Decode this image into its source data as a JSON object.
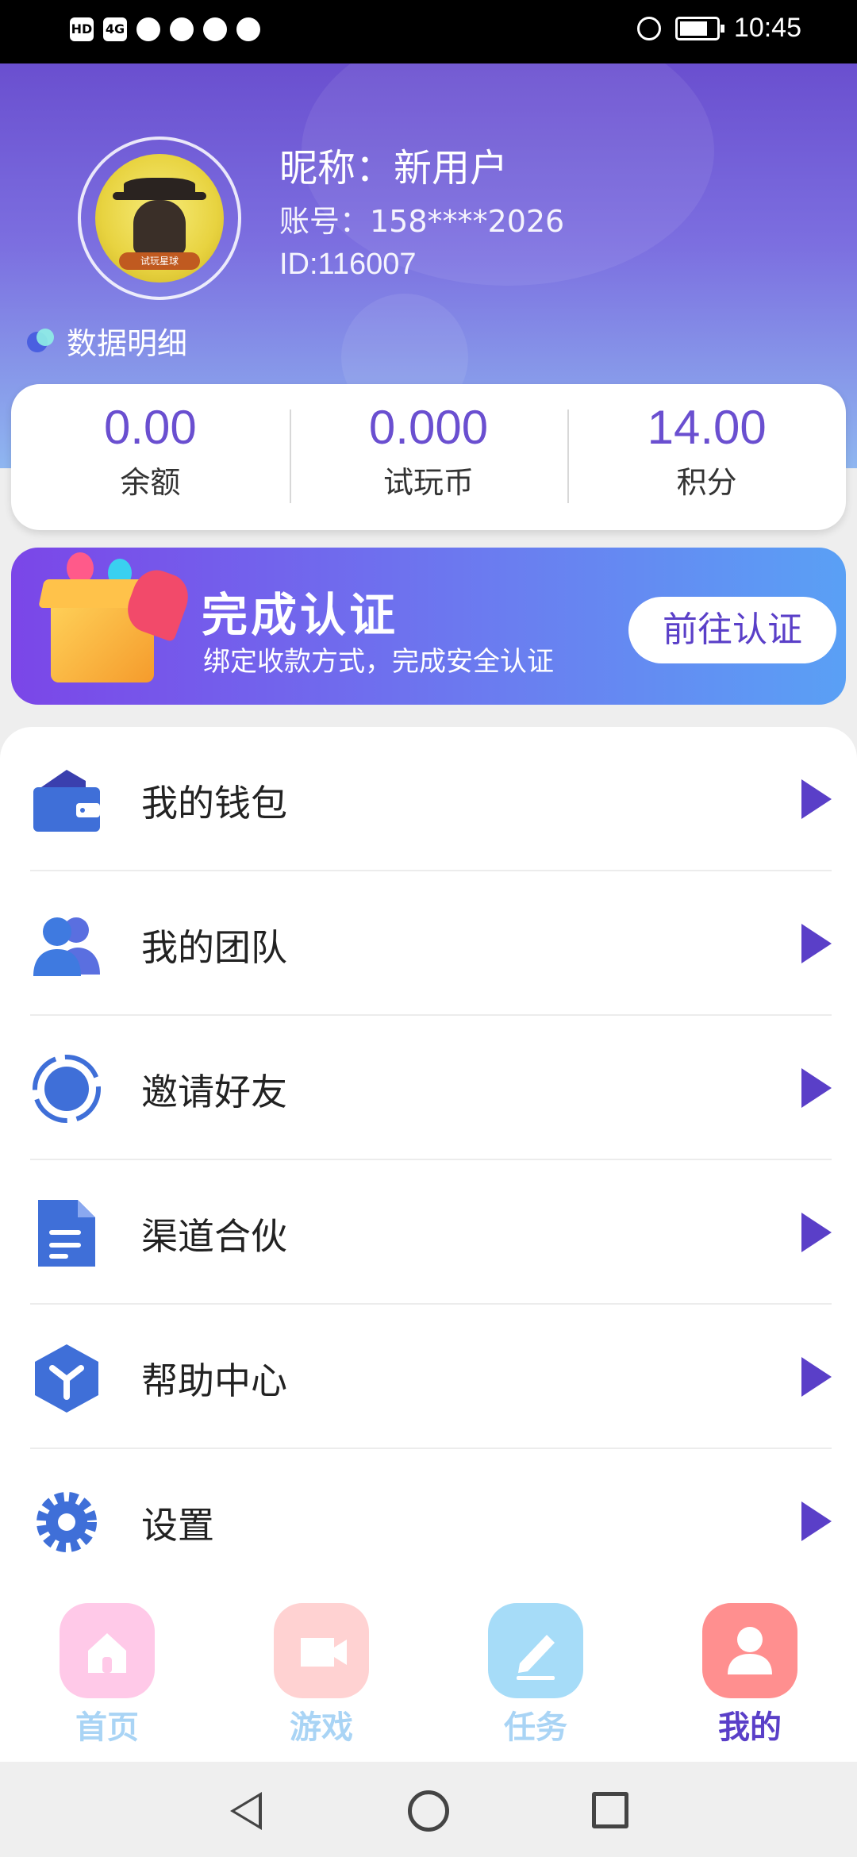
{
  "status_bar": {
    "time": "10:45",
    "left_icons": [
      "HD",
      "4G",
      "signal",
      "wifi",
      "qq",
      "wechat",
      "message"
    ],
    "right_icons": [
      "alarm-icon",
      "battery-icon"
    ]
  },
  "profile": {
    "nickname": "昵称：新用户",
    "account": "账号：158****2026",
    "id": "ID:116007",
    "avatar_label": "试玩星球",
    "data_detail": "数据明细"
  },
  "stats": [
    {
      "value": "0.00",
      "label": "余额"
    },
    {
      "value": "0.000",
      "label": "试玩币"
    },
    {
      "value": "14.00",
      "label": "积分"
    }
  ],
  "banner": {
    "title": "完成认证",
    "subtitle": "绑定收款方式，完成安全认证",
    "button": "前往认证"
  },
  "menu": [
    {
      "label": "我的钱包",
      "icon": "wallet-icon"
    },
    {
      "label": "我的团队",
      "icon": "team-icon"
    },
    {
      "label": "邀请好友",
      "icon": "invite-icon"
    },
    {
      "label": "渠道合伙",
      "icon": "document-icon"
    },
    {
      "label": "帮助中心",
      "icon": "help-cube-icon"
    },
    {
      "label": "设置",
      "icon": "gear-icon"
    }
  ],
  "bottom_nav": [
    {
      "label": "首页",
      "icon": "home-icon",
      "color": "#ffc9e8",
      "label_color": "#a9d4f5"
    },
    {
      "label": "游戏",
      "icon": "game-icon",
      "color": "#ffd2d2",
      "label_color": "#a9d4f5"
    },
    {
      "label": "任务",
      "icon": "task-icon",
      "color": "#a6dcf8",
      "label_color": "#a9d4f5"
    },
    {
      "label": "我的",
      "icon": "user-icon",
      "color": "#ff8f8f",
      "label_color": "#5a3fc8"
    }
  ],
  "colors": {
    "accent": "#5a3fc8",
    "stat_value": "#6a4fd0",
    "icon_blue": "#3f6fd8"
  }
}
